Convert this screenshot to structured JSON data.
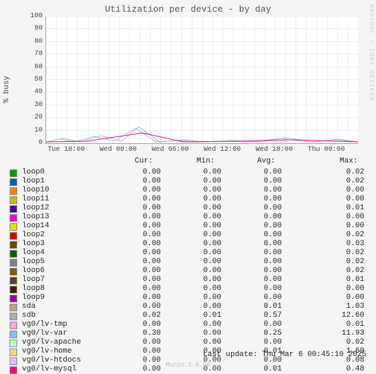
{
  "title": "Utilization per device - by day",
  "ylabel": "% busy",
  "watermark": "RRDTOOL / TOBI OETIKER",
  "footer": "Last update: Thu Mar  6 00:45:10 2025",
  "credit": "Munin 2.0.56",
  "headers": {
    "cur": "Cur:",
    "min": "Min:",
    "avg": "Avg:",
    "max": "Max:"
  },
  "yticks": [
    "0",
    "10",
    "20",
    "30",
    "40",
    "50",
    "60",
    "70",
    "80",
    "90",
    "100"
  ],
  "xticks": [
    "Tue 18:00",
    "Wed 00:00",
    "Wed 06:00",
    "Wed 12:00",
    "Wed 18:00",
    "Thu 00:00"
  ],
  "series": [
    {
      "name": "loop0",
      "color": "#00a000",
      "cur": "0.00",
      "min": "0.00",
      "avg": "0.00",
      "max": "0.02"
    },
    {
      "name": "loop1",
      "color": "#0060c0",
      "cur": "0.00",
      "min": "0.00",
      "avg": "0.00",
      "max": "0.02"
    },
    {
      "name": "loop10",
      "color": "#ff8000",
      "cur": "0.00",
      "min": "0.00",
      "avg": "0.00",
      "max": "0.00"
    },
    {
      "name": "loop11",
      "color": "#c0c000",
      "cur": "0.00",
      "min": "0.00",
      "avg": "0.00",
      "max": "0.00"
    },
    {
      "name": "loop12",
      "color": "#4000a0",
      "cur": "0.00",
      "min": "0.00",
      "avg": "0.00",
      "max": "0.01"
    },
    {
      "name": "loop13",
      "color": "#ff00d0",
      "cur": "0.00",
      "min": "0.00",
      "avg": "0.00",
      "max": "0.00"
    },
    {
      "name": "loop14",
      "color": "#e0e000",
      "cur": "0.00",
      "min": "0.00",
      "avg": "0.00",
      "max": "0.00"
    },
    {
      "name": "loop2",
      "color": "#e00000",
      "cur": "0.00",
      "min": "0.00",
      "avg": "0.00",
      "max": "0.02"
    },
    {
      "name": "loop3",
      "color": "#804000",
      "cur": "0.00",
      "min": "0.00",
      "avg": "0.00",
      "max": "0.03"
    },
    {
      "name": "loop4",
      "color": "#006000",
      "cur": "0.00",
      "min": "0.00",
      "avg": "0.00",
      "max": "0.02"
    },
    {
      "name": "loop5",
      "color": "#808080",
      "cur": "0.00",
      "min": "0.00",
      "avg": "0.00",
      "max": "0.02"
    },
    {
      "name": "loop6",
      "color": "#806000",
      "cur": "0.00",
      "min": "0.00",
      "avg": "0.00",
      "max": "0.02"
    },
    {
      "name": "loop7",
      "color": "#604020",
      "cur": "0.00",
      "min": "0.00",
      "avg": "0.00",
      "max": "0.01"
    },
    {
      "name": "loop8",
      "color": "#402000",
      "cur": "0.00",
      "min": "0.00",
      "avg": "0.00",
      "max": "0.00"
    },
    {
      "name": "loop9",
      "color": "#a000a0",
      "cur": "0.00",
      "min": "0.00",
      "avg": "0.00",
      "max": "0.00"
    },
    {
      "name": "sda",
      "color": "#c0a080",
      "cur": "0.00",
      "min": "0.00",
      "avg": "0.01",
      "max": "1.03"
    },
    {
      "name": "sdb",
      "color": "#b0b0b0",
      "cur": "0.02",
      "min": "0.01",
      "avg": "0.57",
      "max": "12.60"
    },
    {
      "name": "vg0/lv-tmp",
      "color": "#ffa0e0",
      "cur": "0.00",
      "min": "0.00",
      "avg": "0.00",
      "max": "0.01"
    },
    {
      "name": "vg0/lv-var",
      "color": "#80c0ff",
      "cur": "0.30",
      "min": "0.00",
      "avg": "0.25",
      "max": "11.93"
    },
    {
      "name": "vg0/lv-apache",
      "color": "#c0ffc0",
      "cur": "0.00",
      "min": "0.00",
      "avg": "0.00",
      "max": "0.02"
    },
    {
      "name": "vg0/lv-home",
      "color": "#ffd080",
      "cur": "0.00",
      "min": "0.00",
      "avg": "0.01",
      "max": "1.69"
    },
    {
      "name": "vg0/lv-htdocs",
      "color": "#e0c0ff",
      "cur": "0.00",
      "min": "0.00",
      "avg": "0.00",
      "max": "0.08"
    },
    {
      "name": "vg0/lv-mysql",
      "color": "#ff0080",
      "cur": "0.00",
      "min": "0.00",
      "avg": "0.01",
      "max": "0.48"
    }
  ],
  "chart_data": {
    "type": "line",
    "title": "Utilization per device - by day",
    "xlabel": "",
    "ylabel": "% busy",
    "ylim": [
      0,
      105
    ],
    "x": [
      "Tue 18:00",
      "Wed 00:00",
      "Wed 06:00",
      "Wed 12:00",
      "Wed 18:00",
      "Thu 00:00"
    ],
    "series": [
      {
        "name": "loop0",
        "values": [
          0,
          0,
          0,
          0,
          0,
          0
        ]
      },
      {
        "name": "loop1",
        "values": [
          0,
          0,
          0,
          0,
          0,
          0
        ]
      },
      {
        "name": "loop10",
        "values": [
          0,
          0,
          0,
          0,
          0,
          0
        ]
      },
      {
        "name": "loop11",
        "values": [
          0,
          0,
          0,
          0,
          0,
          0
        ]
      },
      {
        "name": "loop12",
        "values": [
          0,
          0,
          0,
          0,
          0,
          0
        ]
      },
      {
        "name": "loop13",
        "values": [
          0,
          0,
          0,
          0,
          0,
          0
        ]
      },
      {
        "name": "loop14",
        "values": [
          0,
          0,
          0,
          0,
          0,
          0
        ]
      },
      {
        "name": "loop2",
        "values": [
          0,
          0,
          0,
          0,
          0,
          0
        ]
      },
      {
        "name": "loop3",
        "values": [
          0,
          0,
          0,
          0,
          0,
          0
        ]
      },
      {
        "name": "loop4",
        "values": [
          0,
          0,
          0,
          0,
          0,
          0
        ]
      },
      {
        "name": "loop5",
        "values": [
          0,
          0,
          0,
          0,
          0,
          0
        ]
      },
      {
        "name": "loop6",
        "values": [
          0,
          0,
          0,
          0,
          0,
          0
        ]
      },
      {
        "name": "loop7",
        "values": [
          0,
          0,
          0,
          0,
          0,
          0
        ]
      },
      {
        "name": "loop8",
        "values": [
          0,
          0,
          0,
          0,
          0,
          0
        ]
      },
      {
        "name": "loop9",
        "values": [
          0,
          0,
          0,
          0,
          0,
          0
        ]
      },
      {
        "name": "sda",
        "values": [
          0.2,
          0.1,
          0.5,
          0.1,
          0.3,
          0
        ]
      },
      {
        "name": "sdb",
        "values": [
          5,
          2,
          12,
          1,
          3,
          0.5
        ]
      },
      {
        "name": "vg0/lv-tmp",
        "values": [
          0,
          0,
          0,
          0,
          0,
          0
        ]
      },
      {
        "name": "vg0/lv-var",
        "values": [
          4,
          2,
          11,
          1,
          2,
          0.3
        ]
      },
      {
        "name": "vg0/lv-apache",
        "values": [
          0,
          0,
          0,
          0,
          0,
          0
        ]
      },
      {
        "name": "vg0/lv-home",
        "values": [
          0.5,
          0.2,
          1,
          0.1,
          0.3,
          0
        ]
      },
      {
        "name": "vg0/lv-htdocs",
        "values": [
          0,
          0,
          0,
          0,
          0,
          0
        ]
      },
      {
        "name": "vg0/lv-mysql",
        "values": [
          0.1,
          0.1,
          0.4,
          0.05,
          0.1,
          0
        ]
      }
    ]
  }
}
